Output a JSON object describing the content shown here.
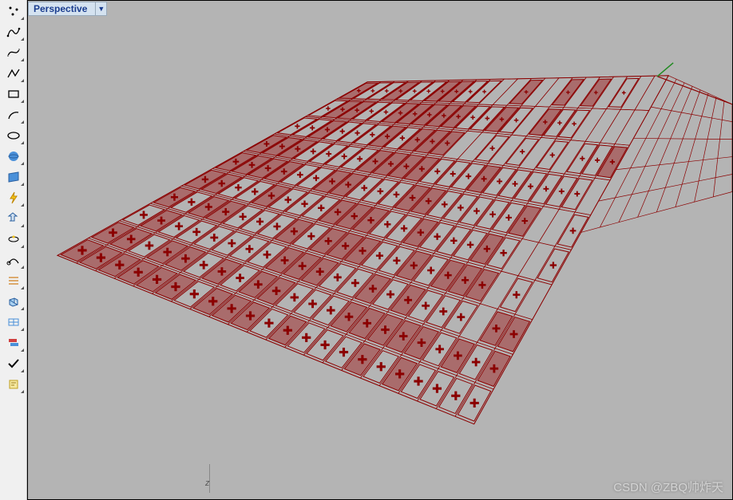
{
  "viewport": {
    "title": "Perspective",
    "dropdown_glyph": "▼",
    "axis_label": "z"
  },
  "watermark": "CSDN @ZBQ帅炸天",
  "toolbar": {
    "tools": [
      "point",
      "point-cloud",
      "curve-interp",
      "curve-control",
      "polyline",
      "rectangle",
      "arc",
      "circle",
      "ellipse",
      "surface-plane",
      "surface-loft",
      "surface-extrude",
      "solid-box",
      "mesh",
      "text",
      "dimension",
      "hatch",
      "offset",
      "fillet",
      "layer",
      "properties",
      "check",
      "script"
    ]
  },
  "scene": {
    "grid": {
      "rows": 10,
      "cols": 22,
      "extra_cols": 8
    },
    "colors": {
      "line": "#8b0000",
      "fill": "#b04040",
      "axis_x": "#8b0000",
      "axis_y": "#228b22"
    },
    "cells_filled_pattern": "random_dense_fade_to_sparse_top_right",
    "marker": "plus"
  }
}
